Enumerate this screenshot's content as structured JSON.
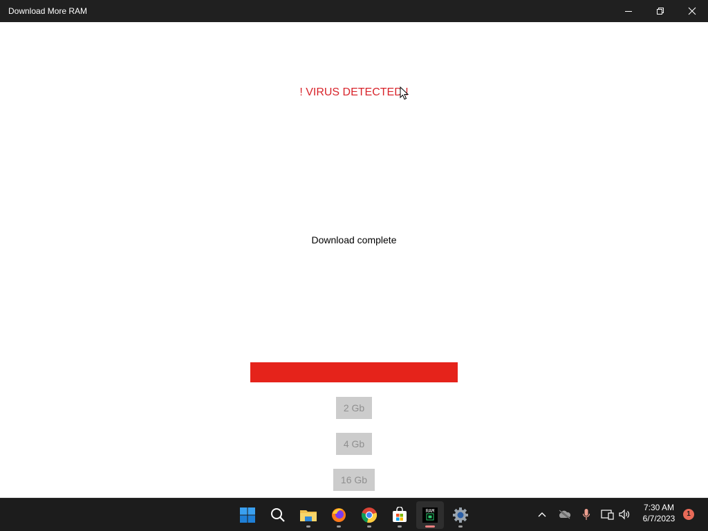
{
  "window": {
    "title": "Download More RAM"
  },
  "app": {
    "alert_text": "! VIRUS DETECTED !",
    "alert_color": "#d8232a",
    "status_text": "Download complete",
    "progress_percent": 100,
    "progress_color": "#e5231b",
    "buttons": [
      {
        "label": "2 Gb"
      },
      {
        "label": "4 Gb"
      },
      {
        "label": "16 Gb"
      }
    ]
  },
  "taskbar": {
    "apps": [
      {
        "name": "start-icon"
      },
      {
        "name": "search-icon"
      },
      {
        "name": "file-explorer-icon"
      },
      {
        "name": "firefox-icon"
      },
      {
        "name": "chrome-icon"
      },
      {
        "name": "microsoft-store-icon"
      },
      {
        "name": "ram-app-icon",
        "label": "RAM"
      },
      {
        "name": "settings-icon"
      }
    ],
    "tray": {
      "time": "7:30 AM",
      "date": "6/7/2023",
      "notification_count": "1"
    }
  }
}
